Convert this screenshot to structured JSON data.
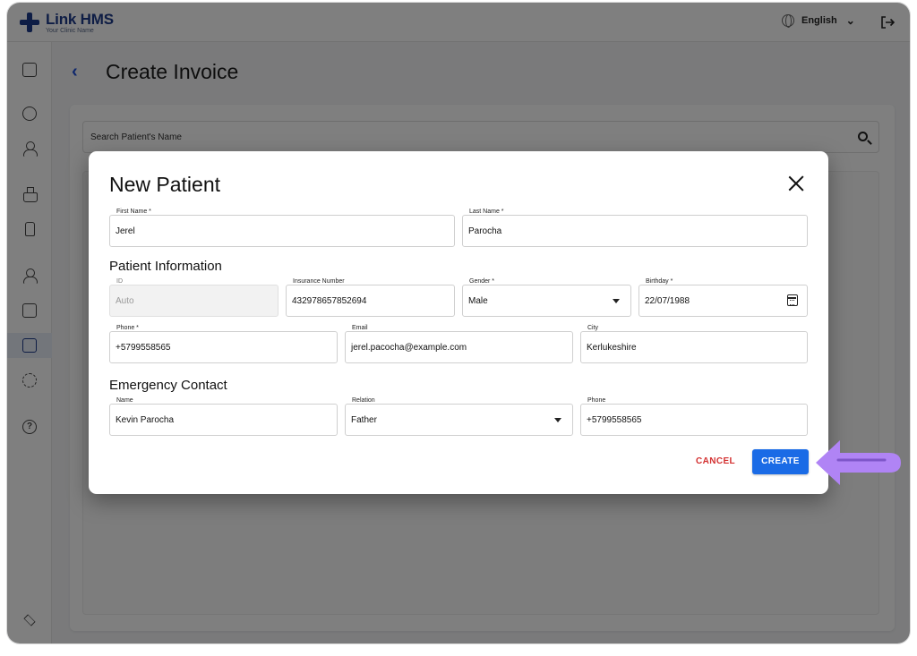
{
  "app": {
    "name": "Link HMS",
    "subtitle": "Your Clinic Name",
    "brand_color": "#1d3a8a"
  },
  "header": {
    "language": "English",
    "language_icon": "globe-icon",
    "logout_icon": "logout-icon"
  },
  "sidebar": {
    "items": [
      {
        "name": "dashboard",
        "icon": "dashboard-icon"
      },
      {
        "name": "appointments",
        "icon": "calendar-icon"
      },
      {
        "name": "patients",
        "icon": "person-icon"
      },
      {
        "name": "laboratory",
        "icon": "flask-icon"
      },
      {
        "name": "pharmacy",
        "icon": "bottle-icon"
      },
      {
        "name": "staff",
        "icon": "group-icon"
      },
      {
        "name": "monitoring",
        "icon": "monitor-icon"
      },
      {
        "name": "invoices",
        "icon": "invoice-icon",
        "active": true
      },
      {
        "name": "settings",
        "icon": "gear-icon"
      },
      {
        "name": "help",
        "icon": "help-icon"
      },
      {
        "name": "learning",
        "icon": "graduation-cap-icon"
      }
    ]
  },
  "page": {
    "title": "Create Invoice",
    "search_placeholder": "Search Patient's Name"
  },
  "modal": {
    "title": "New Patient",
    "first_name": {
      "label": "First Name *",
      "value": "Jerel"
    },
    "last_name": {
      "label": "Last Name *",
      "value": "Parocha"
    },
    "patient_info_title": "Patient Information",
    "id": {
      "label": "ID",
      "value": "Auto"
    },
    "insurance": {
      "label": "Insurance Number",
      "value": "432978657852694"
    },
    "gender": {
      "label": "Gender *",
      "value": "Male"
    },
    "birthday": {
      "label": "Birthday *",
      "value": "22/07/1988"
    },
    "phone": {
      "label": "Phone *",
      "value": "+5799558565"
    },
    "email": {
      "label": "Email",
      "value": "jerel.pacocha@example.com"
    },
    "city": {
      "label": "City",
      "value": "Kerlukeshire"
    },
    "emergency_title": "Emergency Contact",
    "ec_name": {
      "label": "Name",
      "value": "Kevin Parocha"
    },
    "ec_relation": {
      "label": "Relation",
      "value": "Father"
    },
    "ec_phone": {
      "label": "Phone",
      "value": "+5799558565"
    },
    "cancel_label": "CANCEL",
    "create_label": "CREATE"
  },
  "colors": {
    "primary_button": "#1a6be6",
    "cancel_text": "#d32f2f",
    "pointer_arrow": "#b084f5"
  }
}
